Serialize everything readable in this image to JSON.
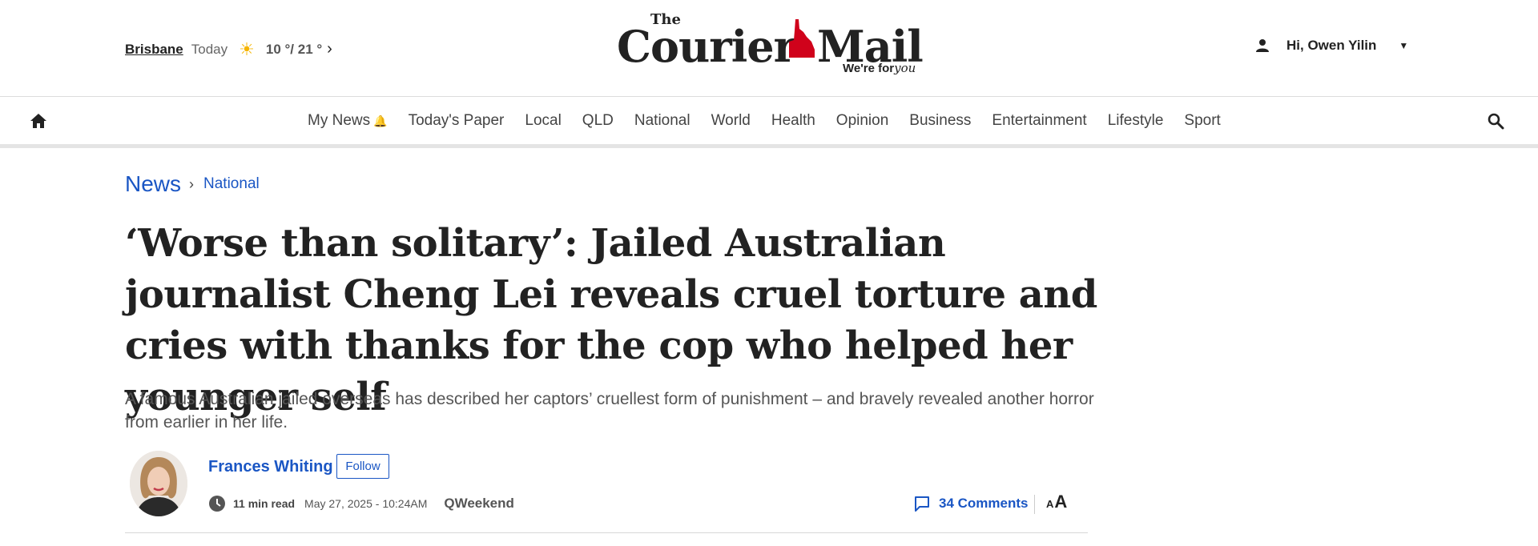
{
  "weather": {
    "city": "Brisbane",
    "day": "Today",
    "temp": "10 °/ 21 °",
    "icon": "sun-icon"
  },
  "logo": {
    "the": "The",
    "word1": "Courier",
    "word2": "Mail",
    "tagline_prefix": "We're for",
    "tagline_script": "you",
    "accent": "#d0021b"
  },
  "user": {
    "greeting": "Hi, Owen Yilin"
  },
  "nav": {
    "items": [
      {
        "label": "My News"
      },
      {
        "label": "Today's Paper"
      },
      {
        "label": "Local"
      },
      {
        "label": "QLD"
      },
      {
        "label": "National"
      },
      {
        "label": "World"
      },
      {
        "label": "Health"
      },
      {
        "label": "Opinion"
      },
      {
        "label": "Business"
      },
      {
        "label": "Entertainment"
      },
      {
        "label": "Lifestyle"
      },
      {
        "label": "Sport"
      }
    ]
  },
  "breadcrumb": {
    "section": "News",
    "subsection": "National"
  },
  "article": {
    "headline": "‘Worse than solitary’: Jailed Australian journalist Cheng Lei reveals cruel torture and cries with thanks for the cop who helped her younger self",
    "standfirst": "A famous Australian jailed overseas has described her captors’ cruellest form of punishment – and bravely revealed another horror from earlier in her life.",
    "author": "Frances Whiting",
    "follow_label": "Follow",
    "read_time": "11 min read",
    "date": "May 27, 2025 - 10:24AM",
    "section": "QWeekend",
    "comments": "34 Comments",
    "font_small": "A",
    "font_large": "A"
  },
  "colors": {
    "link_blue": "#1a56c4",
    "text": "#222222",
    "muted": "#555555"
  }
}
